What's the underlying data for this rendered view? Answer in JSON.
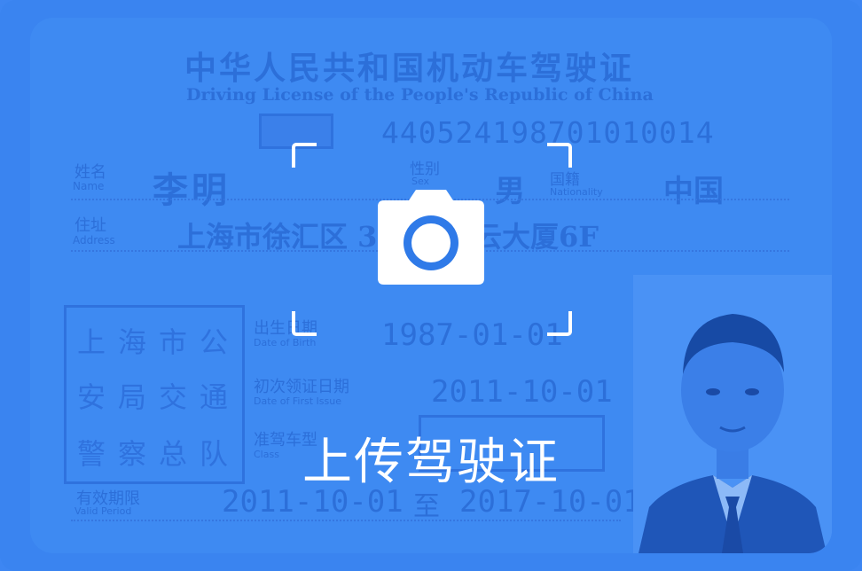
{
  "upload": {
    "label": "上传驾驶证",
    "icon": "camera-icon"
  },
  "license": {
    "title_cn": "中华人民共和国机动车驾驶证",
    "title_en": "Driving License of the People's Republic of China",
    "license_number": "440524198701010014",
    "name_label_cn": "姓名",
    "name_label_en": "Name",
    "name": "李明",
    "sex_label_cn": "性别",
    "sex_label_en": "Sex",
    "sex": "男",
    "nationality_label_cn": "国籍",
    "nationality_label_en": "Nationality",
    "nationality": "中国",
    "address_label_cn": "住址",
    "address_label_en": "Address",
    "address": "上海市徐汇区 397号腾云大厦6F",
    "seal_lines": [
      "上海市公",
      "安局交通",
      "警察总队"
    ],
    "birth_label_cn": "出生日期",
    "birth_label_en": "Date of Birth",
    "birth_date": "1987-01-01",
    "first_issue_label_cn": "初次领证日期",
    "first_issue_label_en": "Date of First Issue",
    "first_issue_date": "2011-10-01",
    "class_label_cn": "准驾车型",
    "class_label_en": "Class",
    "valid_label_cn": "有效期限",
    "valid_label_en": "Valid Period",
    "valid_from": "2011-10-01",
    "valid_to_word": "至",
    "valid_to": "2017-10-01"
  },
  "colors": {
    "overlay_blue": "#3a84f0",
    "icon_white": "#ffffff"
  }
}
